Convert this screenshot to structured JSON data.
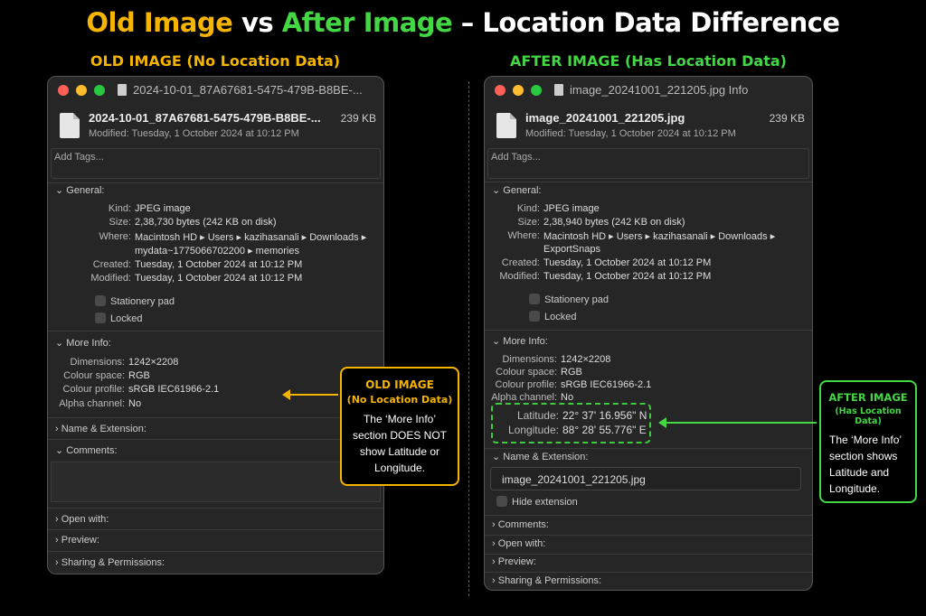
{
  "title": {
    "old": "Old Image",
    "vs": " vs ",
    "after": "After Image",
    "rest": " – Location Data Difference"
  },
  "colors": {
    "old_accent": "#f4b400",
    "after_accent": "#44d744"
  },
  "left": {
    "heading": "OLD IMAGE (No Location Data)",
    "window_title": "2024-10-01_87A67681-5475-479B-B8BE-...",
    "file_name": "2024-10-01_87A67681-5475-479B-B8BE-...",
    "file_size": "239 KB",
    "modified_line": "Modified: Tuesday, 1 October 2024 at 10:12 PM",
    "add_tags": "Add Tags...",
    "general_label": "General:",
    "general": [
      {
        "key": "Kind:",
        "value": "JPEG image"
      },
      {
        "key": "Size:",
        "value": "2,38,730 bytes (242 KB on disk)"
      },
      {
        "key": "Where:",
        "value": "Macintosh HD ▸ Users ▸ kazihasanali ▸ Downloads ▸"
      },
      {
        "key": "",
        "value": "mydata~1775066702200 ▸ memories"
      },
      {
        "key": "Created:",
        "value": "Tuesday, 1 October 2024 at 10:12 PM"
      },
      {
        "key": "Modified:",
        "value": "Tuesday, 1 October 2024 at 10:12 PM"
      }
    ],
    "stationery": "Stationery pad",
    "locked": "Locked",
    "more_info_label": "More Info:",
    "more_info": [
      {
        "key": "Dimensions:",
        "value": "1242×2208"
      },
      {
        "key": "Colour space:",
        "value": "RGB"
      },
      {
        "key": "Colour profile:",
        "value": "sRGB IEC61966-2.1"
      },
      {
        "key": "Alpha channel:",
        "value": "No"
      }
    ],
    "name_ext_label": "Name & Extension:",
    "comments_label": "Comments:",
    "open_with_label": "Open with:",
    "preview_label": "Preview:",
    "sharing_label": "Sharing & Permissions:"
  },
  "right": {
    "heading": "AFTER IMAGE (Has Location Data)",
    "window_title": "image_20241001_221205.jpg Info",
    "file_name": "image_20241001_221205.jpg",
    "file_size": "239 KB",
    "modified_line": "Modified: Tuesday, 1 October 2024 at 10:12 PM",
    "add_tags": "Add Tags...",
    "general_label": "General:",
    "general": [
      {
        "key": "Kind:",
        "value": "JPEG image"
      },
      {
        "key": "Size:",
        "value": "2,38,940 bytes (242 KB on disk)"
      },
      {
        "key": "Where:",
        "value": "Macintosh HD ▸ Users ▸ kazihasanali ▸ Downloads ▸"
      },
      {
        "key": "",
        "value": "ExportSnaps"
      },
      {
        "key": "Created:",
        "value": "Tuesday, 1 October 2024 at 10:12 PM"
      },
      {
        "key": "Modified:",
        "value": "Tuesday, 1 October 2024 at 10:12 PM"
      }
    ],
    "stationery": "Stationery pad",
    "locked": "Locked",
    "more_info_label": "More Info:",
    "more_info": [
      {
        "key": "Dimensions:",
        "value": "1242×2208"
      },
      {
        "key": "Colour space:",
        "value": "RGB"
      },
      {
        "key": "Colour profile:",
        "value": "sRGB IEC61966-2.1"
      },
      {
        "key": "Alpha channel:",
        "value": "No"
      }
    ],
    "latitude": {
      "key": "Latitude:",
      "value": "22° 37' 16.956\" N"
    },
    "longitude": {
      "key": "Longitude:",
      "value": "88° 28' 55.776\" E"
    },
    "name_ext_label": "Name & Extension:",
    "name_field": "image_20241001_221205.jpg",
    "hide_extension": "Hide extension",
    "comments_label": "Comments:",
    "open_with_label": "Open with:",
    "preview_label": "Preview:",
    "sharing_label": "Sharing & Permissions:"
  },
  "callout_old": {
    "h1": "OLD IMAGE",
    "h2": "(No Location Data)",
    "body": "The ‘More Info’ section DOES NOT show Latitude or Longitude."
  },
  "callout_new": {
    "h1": "AFTER IMAGE",
    "h2": "(Has Location Data)",
    "body": "The ‘More Info’ section shows Latitude and Longitude."
  }
}
